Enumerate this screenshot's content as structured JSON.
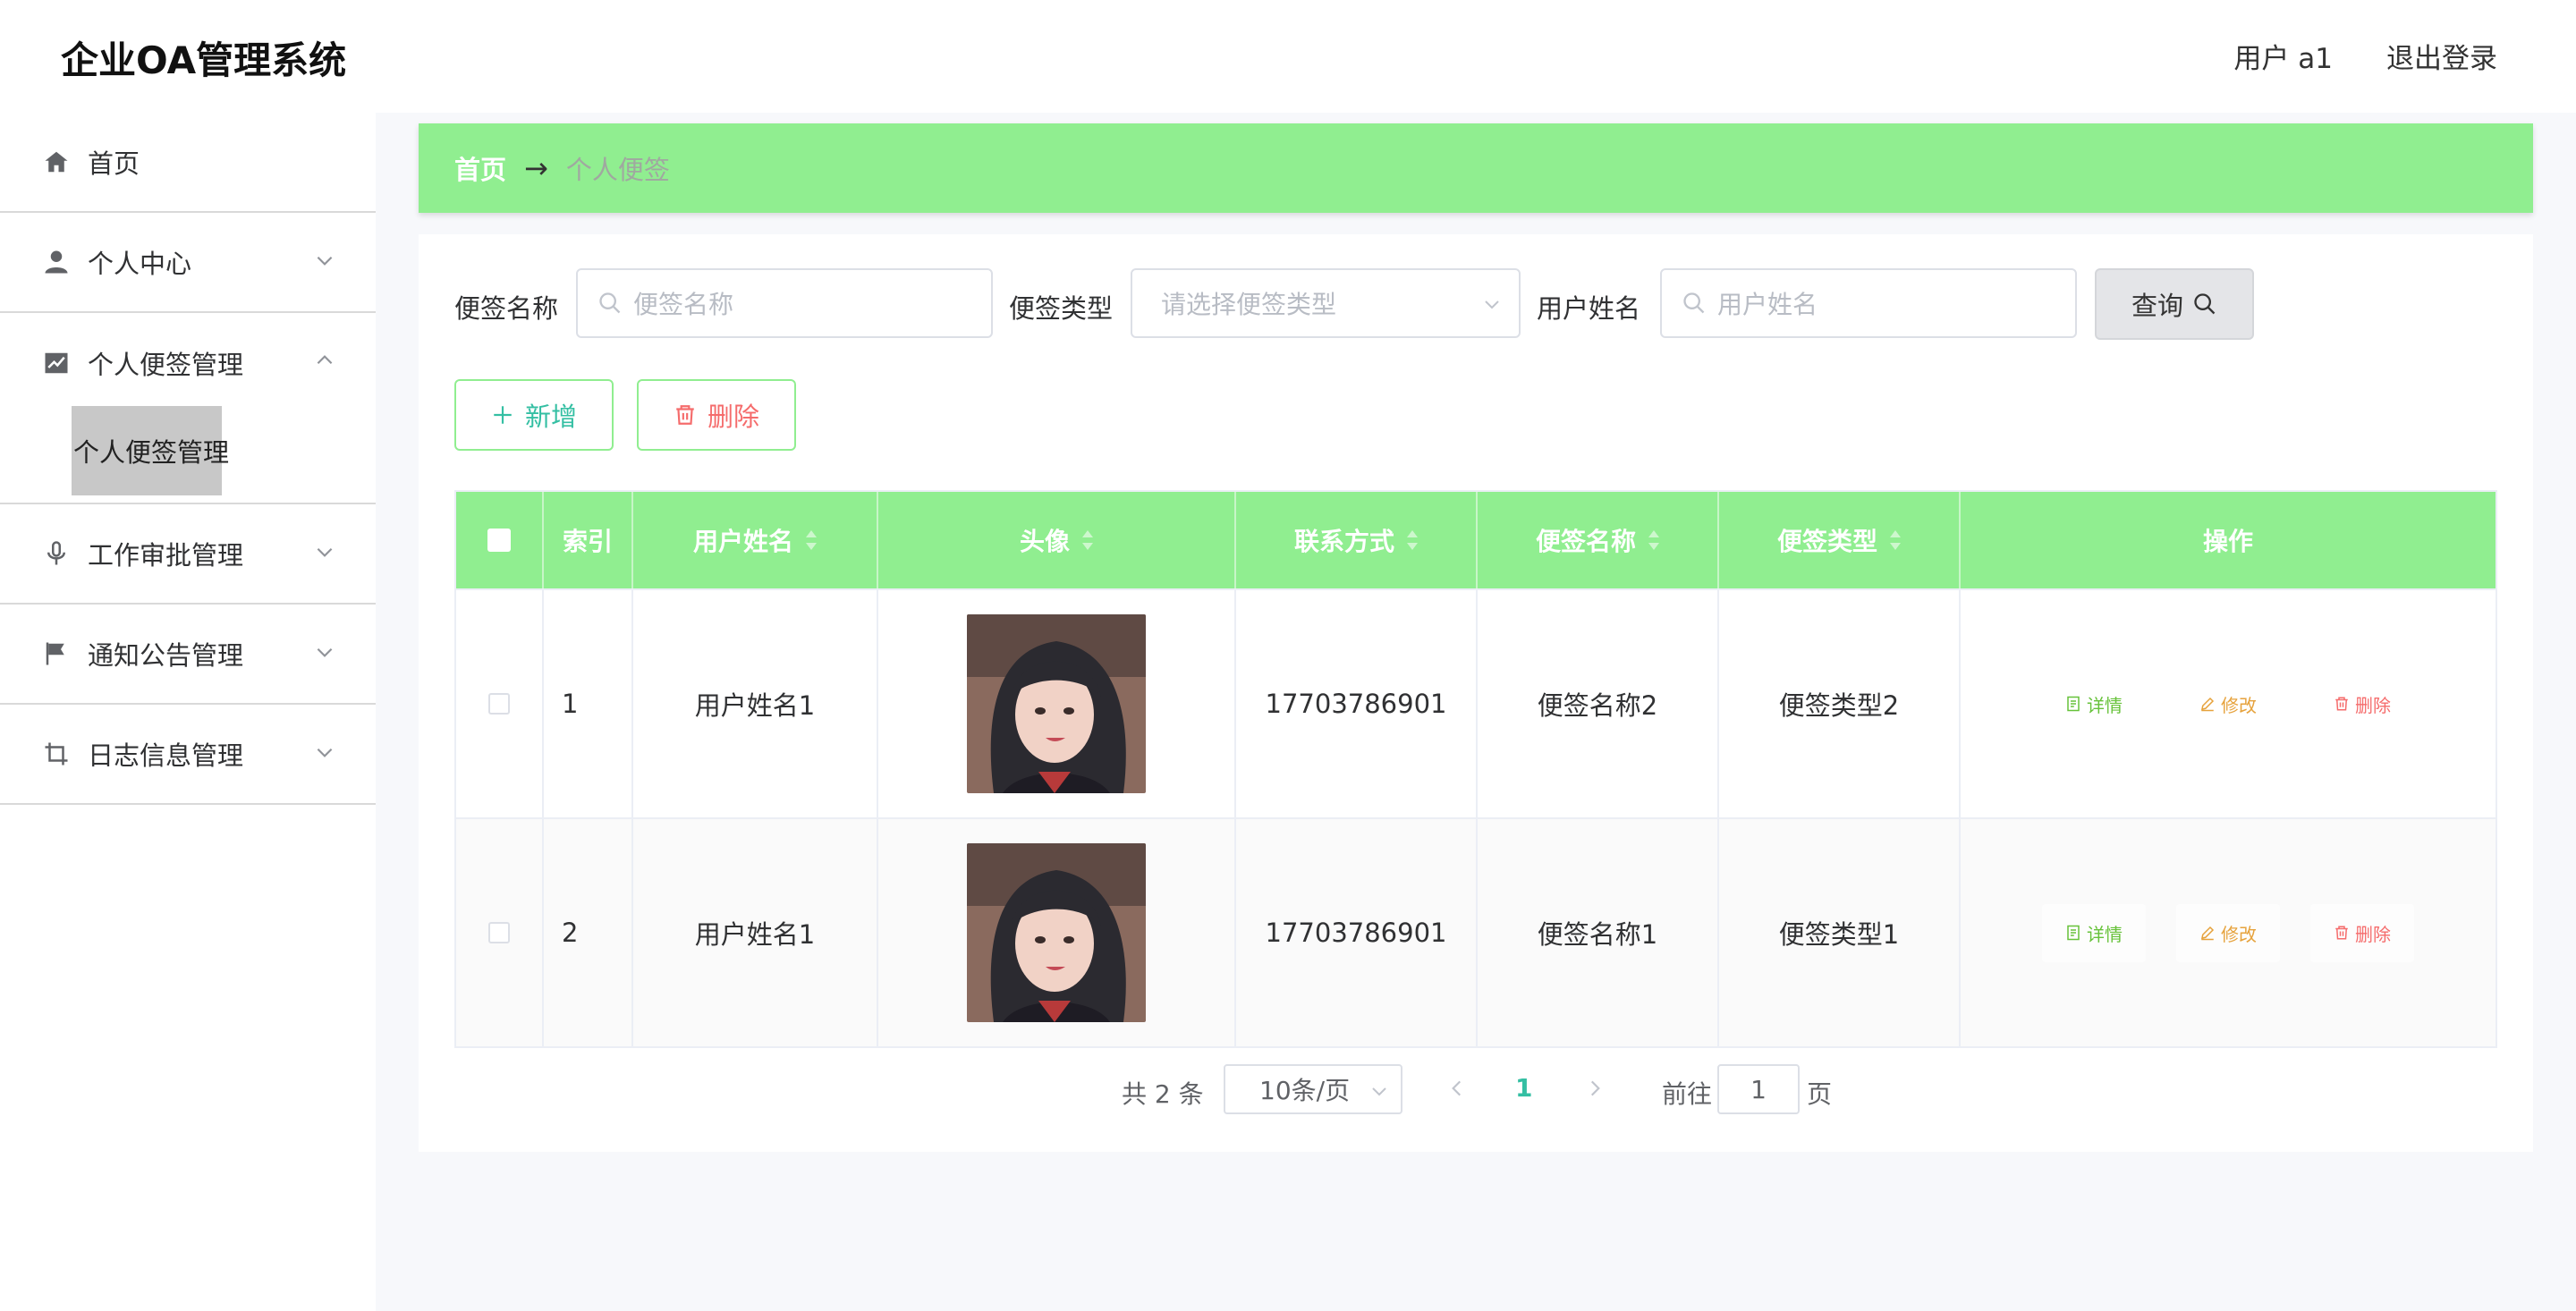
{
  "header": {
    "title": "企业OA管理系统",
    "user_label": "用户 a1",
    "logout": "退出登录"
  },
  "sidebar": {
    "items": [
      {
        "label": "首页",
        "icon": "home-icon"
      },
      {
        "label": "个人中心",
        "icon": "user-icon"
      },
      {
        "label": "个人便签管理",
        "icon": "chart-icon",
        "expanded": true
      },
      {
        "label": "工作审批管理",
        "icon": "microphone-icon"
      },
      {
        "label": "通知公告管理",
        "icon": "flag-icon"
      },
      {
        "label": "日志信息管理",
        "icon": "crop-icon"
      }
    ],
    "active_subitem": "个人便签管理"
  },
  "breadcrumb": {
    "home": "首页",
    "arrow": "→",
    "current": "个人便签"
  },
  "filters": {
    "note_name_label": "便签名称",
    "note_name_placeholder": "便签名称",
    "note_type_label": "便签类型",
    "note_type_placeholder": "请选择便签类型",
    "user_name_label": "用户姓名",
    "user_name_placeholder": "用户姓名",
    "query_button": "查询"
  },
  "actions": {
    "add": "新增",
    "delete": "删除"
  },
  "table": {
    "columns": [
      "索引",
      "用户姓名",
      "头像",
      "联系方式",
      "便签名称",
      "便签类型",
      "操作"
    ],
    "rows": [
      {
        "index": "1",
        "user_name": "用户姓名1",
        "phone": "17703786901",
        "note_name": "便签名称2",
        "note_type": "便签类型2"
      },
      {
        "index": "2",
        "user_name": "用户姓名1",
        "phone": "17703786901",
        "note_name": "便签名称1",
        "note_type": "便签类型1"
      }
    ],
    "row_actions": {
      "detail": "详情",
      "edit": "修改",
      "remove": "删除"
    }
  },
  "pagination": {
    "total": "共 2 条",
    "page_size": "10条/页",
    "current_page": "1",
    "goto_label": "前往",
    "goto_value": "1",
    "page_suffix": "页"
  },
  "colors": {
    "accent_green": "#90ee90",
    "teal": "#34bfa3",
    "danger": "#f56c6c",
    "warning": "#e6a23c",
    "success": "#67c23a"
  }
}
